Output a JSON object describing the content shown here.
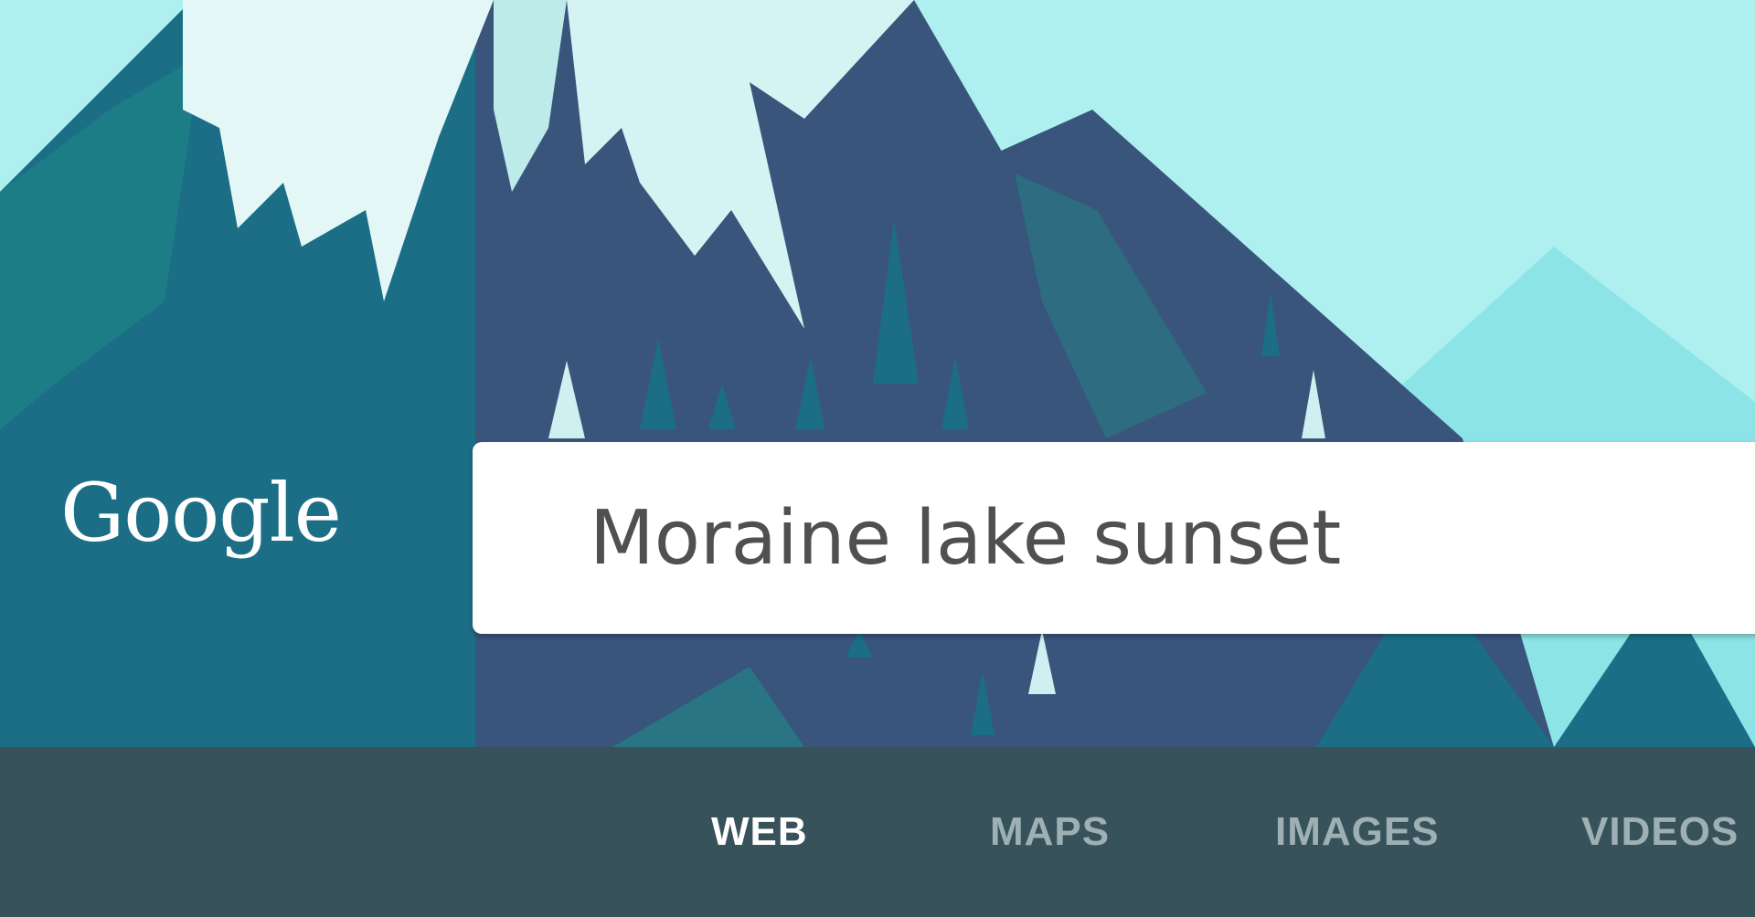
{
  "branding": {
    "logo_text": "Google"
  },
  "search": {
    "query": "Moraine lake sunset"
  },
  "tabs": [
    {
      "label": "WEB",
      "active": true
    },
    {
      "label": "MAPS",
      "active": false
    },
    {
      "label": "IMAGES",
      "active": false
    },
    {
      "label": "VIDEOS",
      "active": false
    }
  ],
  "colors": {
    "sky": "#aef0f0",
    "tab_bar": "#37525a",
    "tab_active": "#ffffff",
    "tab_inactive": "#9fb0b4",
    "mountain_dark": "#39557c",
    "mountain_teal": "#1b6e85",
    "snow": "#e3f7f7"
  }
}
